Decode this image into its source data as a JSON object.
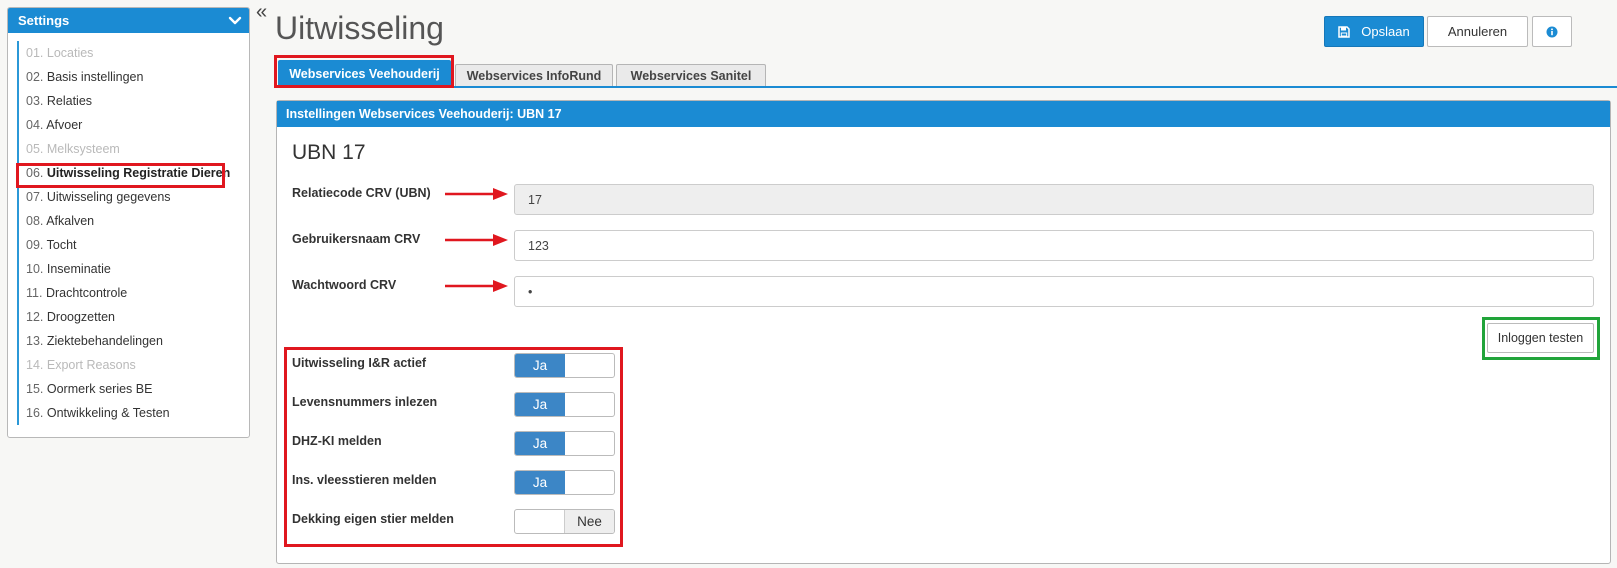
{
  "sidebar": {
    "title": "Settings",
    "items": [
      {
        "num": "01.",
        "label": "Locaties",
        "state": "disabled"
      },
      {
        "num": "02.",
        "label": "Basis instellingen",
        "state": "normal"
      },
      {
        "num": "03.",
        "label": "Relaties",
        "state": "normal"
      },
      {
        "num": "04.",
        "label": "Afvoer",
        "state": "normal"
      },
      {
        "num": "05.",
        "label": "Melksysteem",
        "state": "disabled"
      },
      {
        "num": "06.",
        "label": "Uitwisseling Registratie Dieren",
        "state": "active"
      },
      {
        "num": "07.",
        "label": "Uitwisseling gegevens",
        "state": "normal"
      },
      {
        "num": "08.",
        "label": "Afkalven",
        "state": "normal"
      },
      {
        "num": "09.",
        "label": "Tocht",
        "state": "normal"
      },
      {
        "num": "10.",
        "label": "Inseminatie",
        "state": "normal"
      },
      {
        "num": "11.",
        "label": "Drachtcontrole",
        "state": "normal"
      },
      {
        "num": "12.",
        "label": "Droogzetten",
        "state": "normal"
      },
      {
        "num": "13.",
        "label": "Ziektebehandelingen",
        "state": "normal"
      },
      {
        "num": "14.",
        "label": "Export Reasons",
        "state": "disabled"
      },
      {
        "num": "15.",
        "label": "Oormerk series BE",
        "state": "normal"
      },
      {
        "num": "16.",
        "label": "Ontwikkeling & Testen",
        "state": "normal"
      }
    ]
  },
  "collapse_glyph": "«",
  "page": {
    "title": "Uitwisseling",
    "save_label": "Opslaan",
    "cancel_label": "Annuleren"
  },
  "tabs": [
    {
      "label": "Webservices Veehouderij",
      "active": true
    },
    {
      "label": "Webservices InfoRund",
      "active": false
    },
    {
      "label": "Webservices Sanitel",
      "active": false
    }
  ],
  "panel": {
    "header": "Instellingen Webservices Veehouderij: UBN 17",
    "section_title": "UBN 17",
    "fields": {
      "relatiecode": {
        "label": "Relatiecode CRV (UBN)",
        "value": "17"
      },
      "gebruikersnaam": {
        "label": "Gebruikersnaam CRV",
        "value": "123"
      },
      "wachtwoord": {
        "label": "Wachtwoord CRV",
        "value": "•"
      }
    },
    "test_login_label": "Inloggen testen",
    "toggles": [
      {
        "label": "Uitwisseling I&R actief",
        "value": "Ja",
        "on": true
      },
      {
        "label": "Levensnummers inlezen",
        "value": "Ja",
        "on": true
      },
      {
        "label": "DHZ-KI melden",
        "value": "Ja",
        "on": true
      },
      {
        "label": "Ins. vleesstieren melden",
        "value": "Ja",
        "on": true
      },
      {
        "label": "Dekking eigen stier melden",
        "value": "Nee",
        "on": false
      }
    ]
  },
  "colors": {
    "accent": "#1b8bd3",
    "toggle_on": "#3c86c6",
    "highlight_red": "#e0171f",
    "highlight_green": "#21a43a"
  }
}
